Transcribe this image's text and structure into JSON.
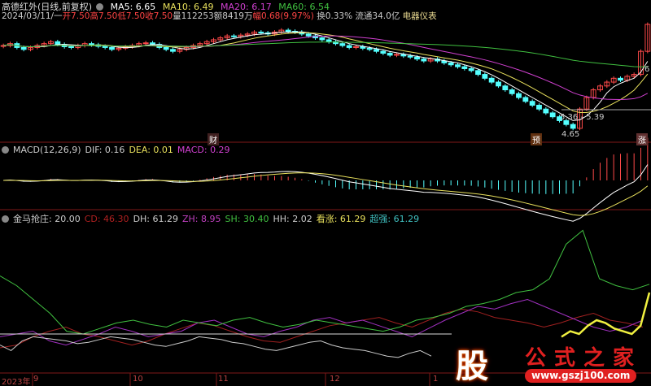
{
  "header": {
    "title": "高德红外(日线,前复权)",
    "ma5": "MA5: 6.65",
    "ma10": "MA10: 6.49",
    "ma20": "MA20: 6.17",
    "ma60": "MA60: 6.54"
  },
  "quote": {
    "date": "2024/03/11/一",
    "open": "开7.50",
    "high": "高7.50",
    "low": "低7.50",
    "close": "收7.50",
    "volume": "量112253",
    "amount": "额8419万",
    "change": "幅0.68(9.97%)",
    "turnover": "换0.33%",
    "float": "流通34.0亿",
    "sector": "电器仪表"
  },
  "price": {
    "closes": [
      6.95,
      7.0,
      6.9,
      6.85,
      6.9,
      6.95,
      7.0,
      7.05,
      6.98,
      6.92,
      6.9,
      6.95,
      7.0,
      6.97,
      6.93,
      6.9,
      6.85,
      6.88,
      6.92,
      6.95,
      7.0,
      7.02,
      6.98,
      6.9,
      6.85,
      6.8,
      6.85,
      6.9,
      6.95,
      7.0,
      7.05,
      7.1,
      7.15,
      7.2,
      7.18,
      7.22,
      7.25,
      7.3,
      7.28,
      7.25,
      7.3,
      7.35,
      7.32,
      7.3,
      7.25,
      7.2,
      7.15,
      7.1,
      7.05,
      7.0,
      6.95,
      6.9,
      6.92,
      6.88,
      6.85,
      6.8,
      6.75,
      6.7,
      6.72,
      6.68,
      6.65,
      6.6,
      6.55,
      6.6,
      6.55,
      6.5,
      6.45,
      6.4,
      6.35,
      6.3,
      6.2,
      6.1,
      6.0,
      5.9,
      5.8,
      5.7,
      5.6,
      5.5,
      5.4,
      5.3,
      5.2,
      5.1,
      5.0,
      4.9,
      4.8,
      5.3,
      5.6,
      5.8,
      5.9,
      6.0,
      6.1,
      6.05,
      6.15,
      6.2,
      6.8,
      7.5
    ],
    "max": 7.5,
    "min": 4.65
  },
  "annotations": {
    "range": "5.36 - 5.39",
    "low": "4.65",
    "cai": "财",
    "yu": "预",
    "zhang": "涨",
    "last": "6"
  },
  "macd": {
    "title": "MACD(12,26,9)",
    "dif": "DIF: 0.16",
    "dea": "DEA: 0.01",
    "macd": "MACD: 0.29"
  },
  "ind": {
    "title": "金马抢庄",
    "val": ": 20.00",
    "cd": "CD: 46.30",
    "dh": "DH: 61.29",
    "zh": "ZH: 8.95",
    "sh": "SH: 30.40",
    "hh": "HH: 2.02",
    "kz": "看涨: 61.29",
    "cq": "超强: 61.29",
    "green": [
      62,
      55,
      45,
      35,
      22,
      20,
      24,
      28,
      30,
      27,
      25,
      30,
      28,
      26,
      30,
      32,
      28,
      25,
      27,
      30,
      28,
      26,
      24,
      22,
      25,
      30,
      32,
      35,
      40,
      42,
      45,
      50,
      52,
      60,
      85,
      95,
      60,
      55,
      52,
      56
    ],
    "purple": [
      18,
      20,
      22,
      15,
      12,
      16,
      20,
      25,
      22,
      18,
      20,
      22,
      28,
      30,
      25,
      20,
      18,
      22,
      25,
      30,
      32,
      28,
      30,
      26,
      22,
      18,
      24,
      30,
      35,
      40,
      38,
      42,
      45,
      40,
      35,
      30,
      25,
      22,
      25,
      30
    ],
    "red": [
      10,
      12,
      18,
      22,
      25,
      20,
      18,
      15,
      12,
      15,
      20,
      24,
      28,
      26,
      22,
      18,
      15,
      14,
      18,
      22,
      26,
      28,
      30,
      32,
      28,
      25,
      30,
      35,
      38,
      36,
      32,
      30,
      28,
      25,
      28,
      32,
      35,
      30,
      28,
      25
    ],
    "white": [
      12,
      8,
      15,
      18,
      17,
      16,
      15,
      13,
      14,
      16,
      18,
      17,
      16,
      14,
      12,
      11,
      13,
      15,
      18,
      17,
      16,
      14,
      13,
      11,
      9,
      8,
      10,
      12,
      14,
      15,
      12,
      10,
      9,
      8,
      6,
      4,
      3,
      6,
      8,
      4
    ],
    "yellow": [
      18,
      22,
      20,
      26,
      30,
      28,
      24,
      22,
      20,
      26,
      50
    ],
    "line": 20
  },
  "axis": {
    "labels": [
      "2023年",
      "9",
      "10",
      "11",
      "12",
      "1"
    ]
  },
  "watermark": {
    "logo": "股",
    "name": "公式之家",
    "url": "www.gszj100.com"
  },
  "colors": {
    "up": "#ff4a4a",
    "down": "#54ffff",
    "ma5": "#ffffff",
    "ma10": "#e8e05c",
    "ma20": "#d040d0",
    "ma60": "#40c040"
  }
}
